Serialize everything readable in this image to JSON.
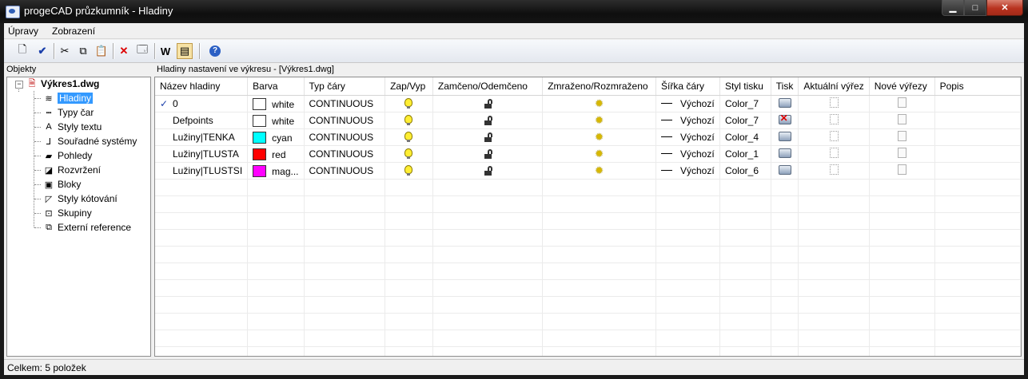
{
  "window": {
    "title": "progeCAD průzkumník - Hladiny"
  },
  "menu": [
    "Úpravy",
    "Zobrazení"
  ],
  "left_panel": {
    "header": "Objekty",
    "root": "Výkres1.dwg",
    "items": [
      {
        "label": "Hladiny",
        "icon": "layers-icon",
        "selected": true
      },
      {
        "label": "Typy čar",
        "icon": "linetypes-icon"
      },
      {
        "label": "Styly textu",
        "icon": "text-style-icon"
      },
      {
        "label": "Souřadné systémy",
        "icon": "ucs-icon"
      },
      {
        "label": "Pohledy",
        "icon": "views-icon"
      },
      {
        "label": "Rozvržení",
        "icon": "layouts-icon"
      },
      {
        "label": "Bloky",
        "icon": "blocks-icon"
      },
      {
        "label": "Styly kótování",
        "icon": "dimstyles-icon"
      },
      {
        "label": "Skupiny",
        "icon": "groups-icon"
      },
      {
        "label": "Externí reference",
        "icon": "xref-icon"
      }
    ]
  },
  "right_panel": {
    "header": "Hladiny nastavení ve výkresu - [Výkres1.dwg]",
    "columns": [
      "Název hladiny",
      "Barva",
      "Typ čáry",
      "Zap/Vyp",
      "Zamčeno/Odemčeno",
      "Zmraženo/Rozmraženo",
      "Šířka čáry",
      "Styl tisku",
      "Tisk",
      "Aktuální výřez",
      "Nové výřezy",
      "Popis"
    ],
    "rows": [
      {
        "name": "0",
        "current": true,
        "color": "white",
        "swatch": "#ffffff",
        "linetype": "CONTINUOUS",
        "lineweight": "Výchozí",
        "plotstyle": "Color_7",
        "plot": true
      },
      {
        "name": "Defpoints",
        "current": false,
        "color": "white",
        "swatch": "#ffffff",
        "linetype": "CONTINUOUS",
        "lineweight": "Výchozí",
        "plotstyle": "Color_7",
        "plot": false
      },
      {
        "name": "Lužiny|TENKA",
        "current": false,
        "color": "cyan",
        "swatch": "#00ffff",
        "linetype": "CONTINUOUS",
        "lineweight": "Výchozí",
        "plotstyle": "Color_4",
        "plot": true
      },
      {
        "name": "Lužiny|TLUSTA",
        "current": false,
        "color": "red",
        "swatch": "#ff0000",
        "linetype": "CONTINUOUS",
        "lineweight": "Výchozí",
        "plotstyle": "Color_1",
        "plot": true
      },
      {
        "name": "Lužiny|TLUSTSI",
        "current": false,
        "color": "mag...",
        "swatch": "#ff00ff",
        "linetype": "CONTINUOUS",
        "lineweight": "Výchozí",
        "plotstyle": "Color_6",
        "plot": true
      }
    ]
  },
  "status": "Celkem: 5 položek"
}
